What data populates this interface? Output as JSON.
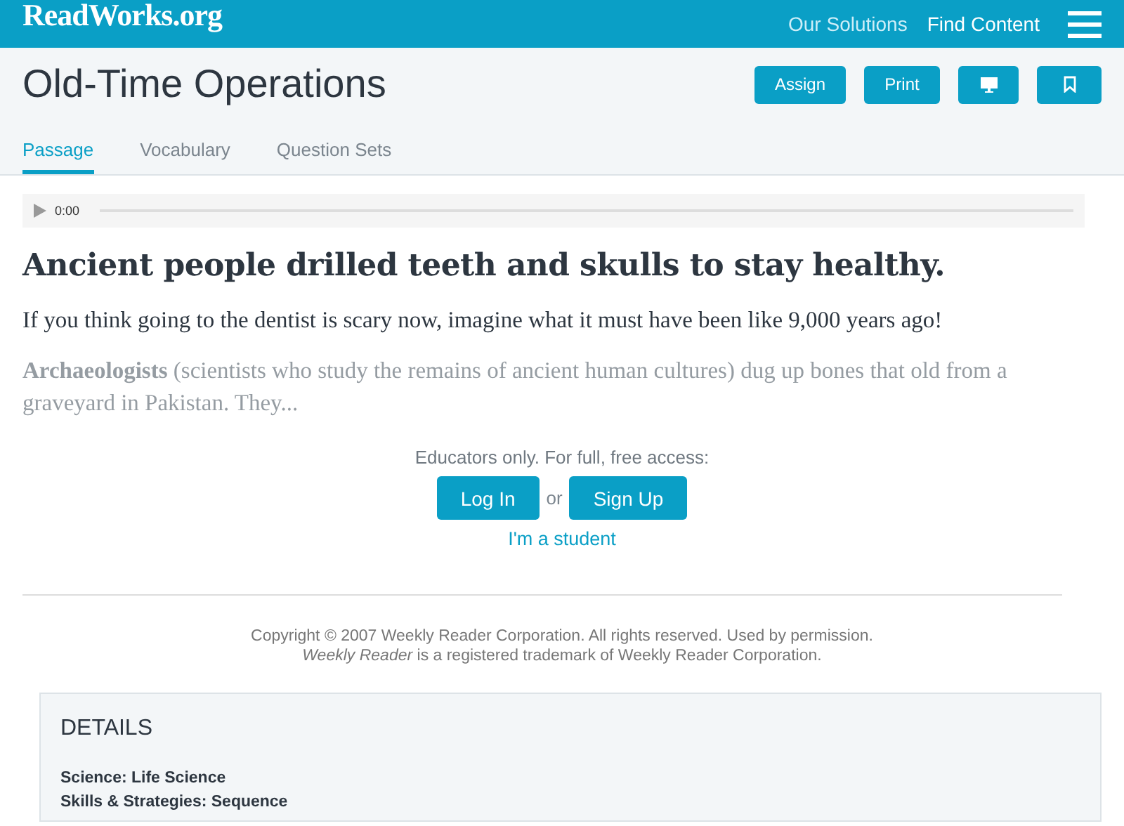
{
  "header": {
    "logo": "ReadWorks.org",
    "nav": [
      {
        "label": "Our Solutions",
        "selected": false
      },
      {
        "label": "Find Content",
        "selected": true
      }
    ]
  },
  "title": "Old-Time Operations",
  "actions": [
    {
      "kind": "text",
      "label": "Assign"
    },
    {
      "kind": "text",
      "label": "Print"
    },
    {
      "kind": "monitor"
    },
    {
      "kind": "bookmark"
    }
  ],
  "tabs": [
    {
      "label": "Passage",
      "selected": true
    },
    {
      "label": "Vocabulary",
      "selected": false
    },
    {
      "label": "Question Sets",
      "selected": false
    }
  ],
  "audio": {
    "time": "0:00"
  },
  "heading": "Ancient people drilled teeth and skulls to stay healthy.",
  "intro": "If you think going to the dentist is scary now, imagine what it must have been like 9,000 years ago!",
  "preview": "**Archaeologists** (scientists who study the remains of ancient human cultures) dug up bones that old from a graveyard in Pakistan. They...",
  "access": {
    "prompt": "Educators only. For full, free access:",
    "login": "Log In",
    "or": "or",
    "signup": "Sign Up",
    "student": "I'm a student"
  },
  "copyright": [
    "Copyright © 2007 Weekly Reader Corporation. All rights reserved. Used by permission.",
    "*Weekly Reader* is a registered trademark of Weekly Reader Corporation."
  ],
  "details": {
    "title": "DETAILS",
    "items": [
      "Science: Life Science",
      "Skills & Strategies: Sequence"
    ]
  }
}
